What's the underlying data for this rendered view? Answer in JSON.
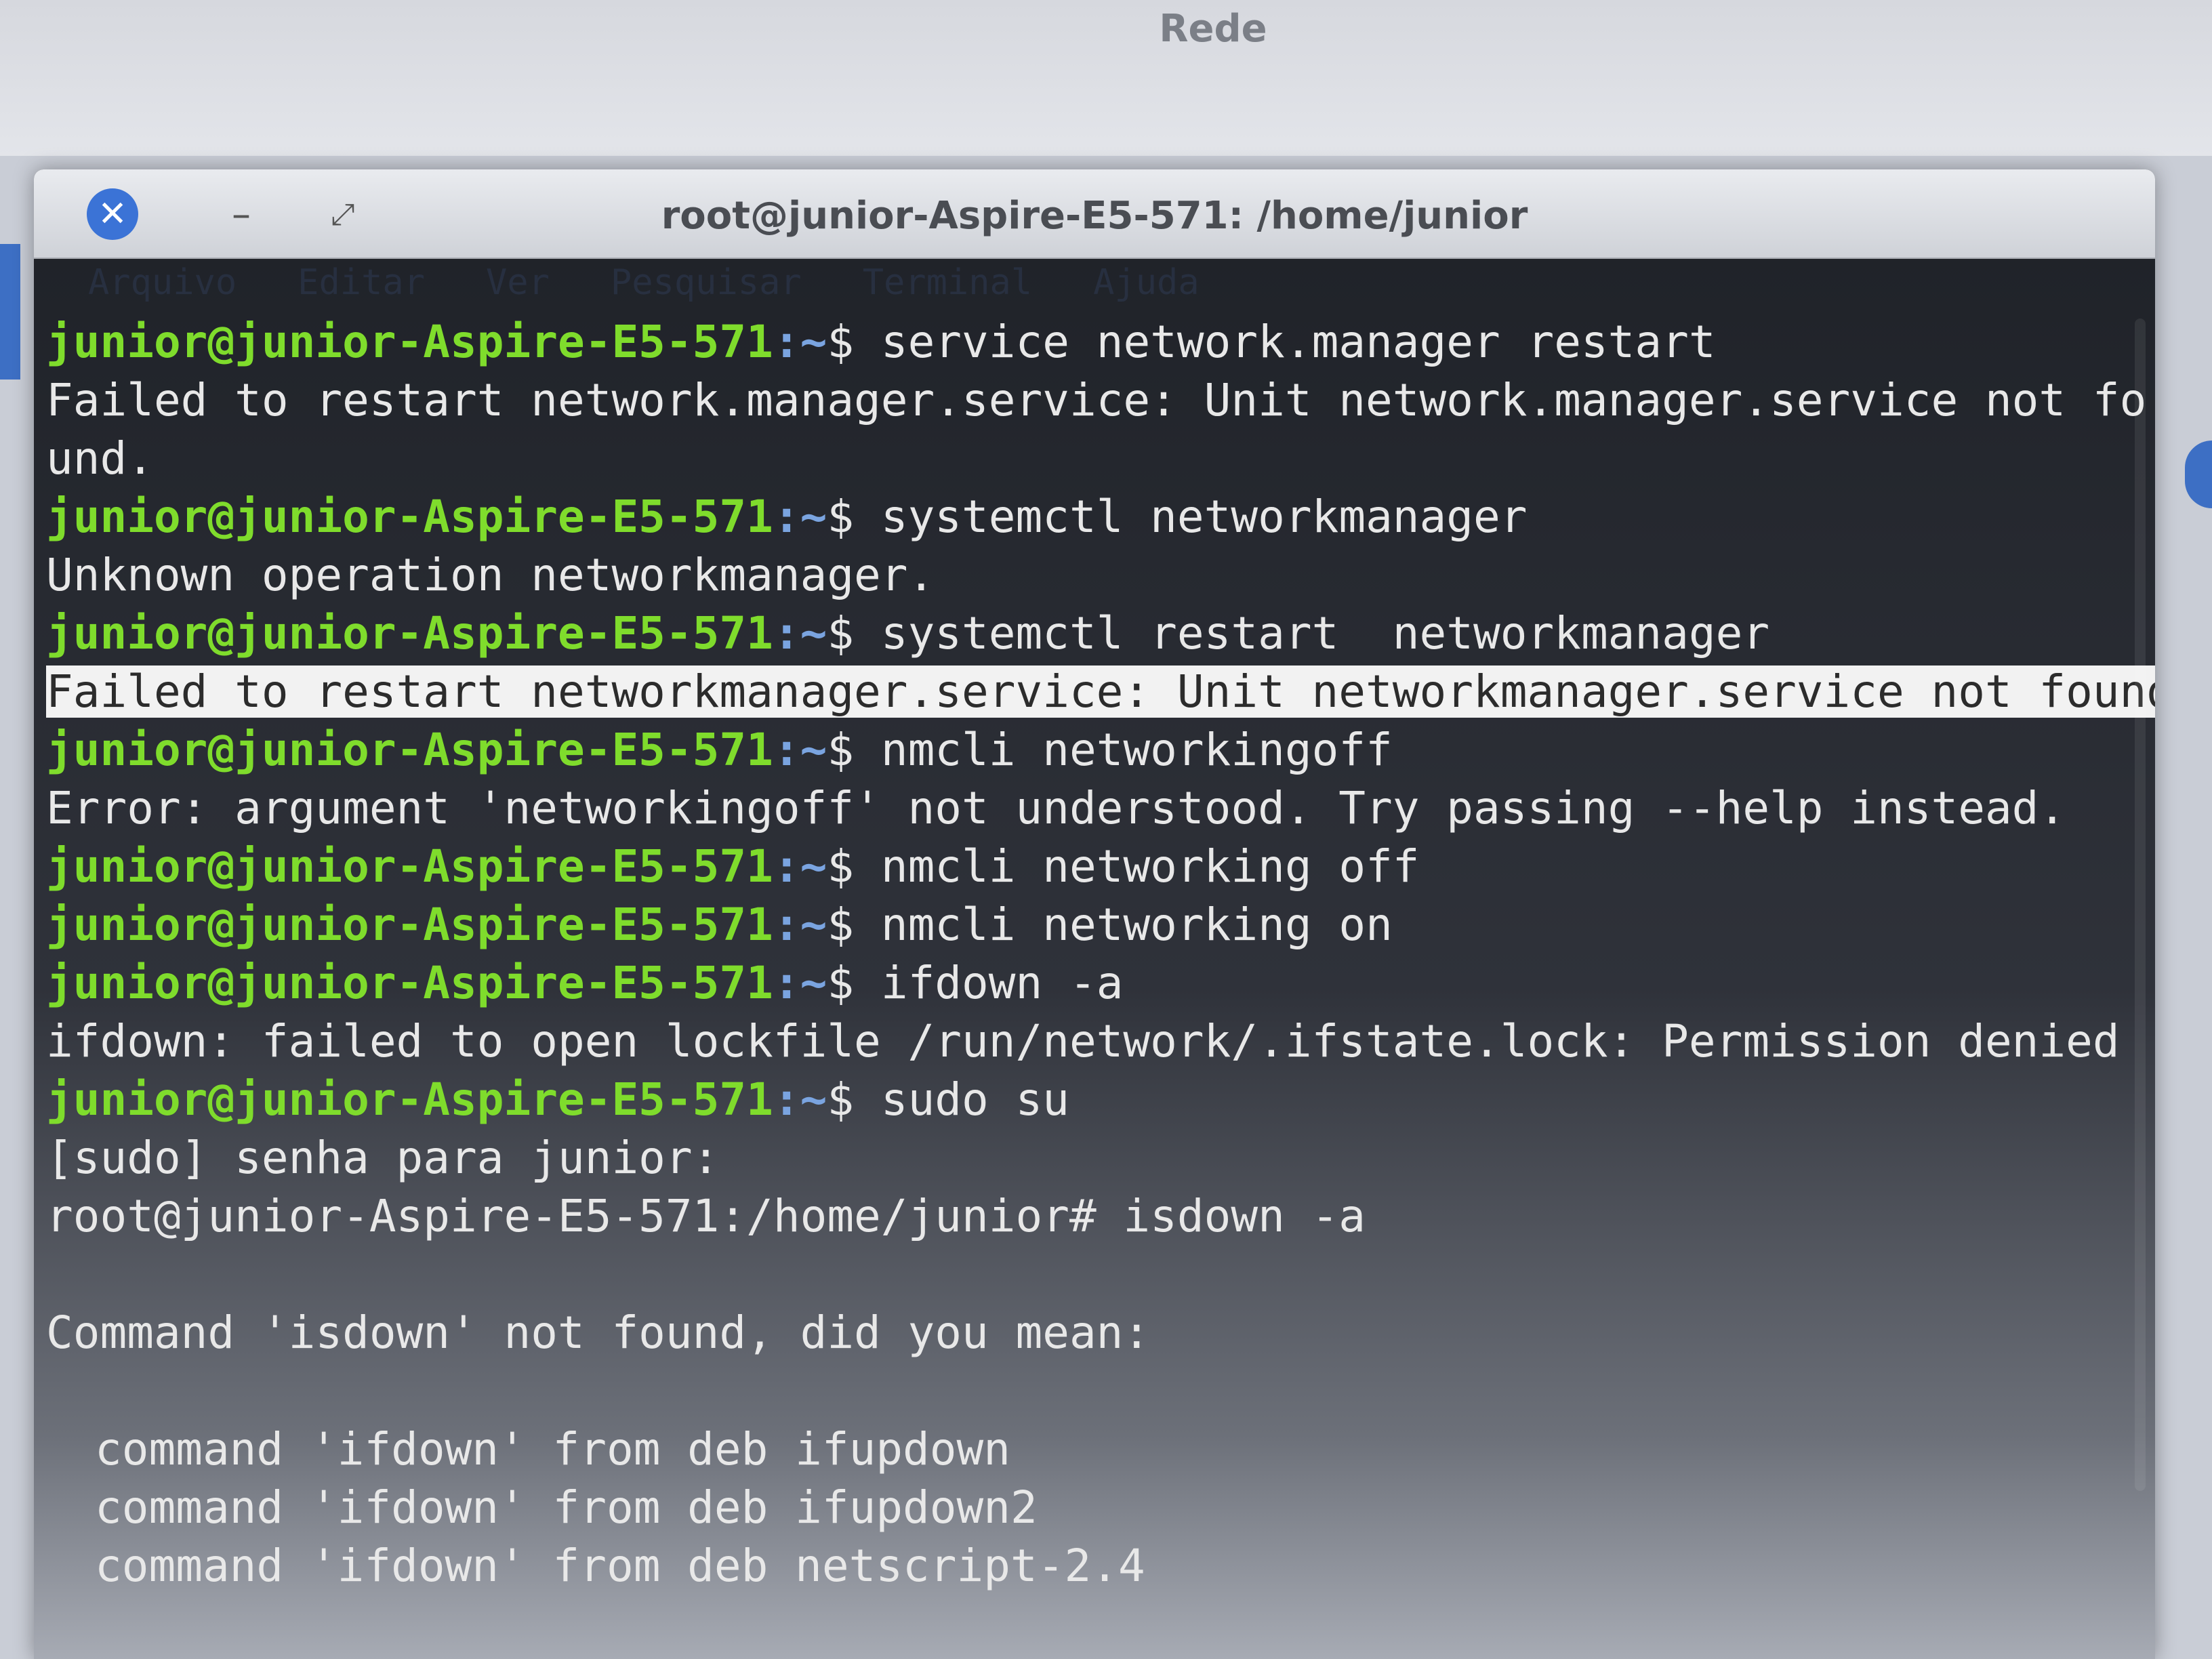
{
  "background_window": {
    "title": "Rede"
  },
  "window": {
    "title": "root@junior-Aspire-E5-571: /home/junior",
    "close_icon": "close-icon",
    "minimize_icon": "minimize-icon",
    "maximize_icon": "maximize-icon"
  },
  "menu": {
    "items": [
      "Arquivo",
      "Editar",
      "Ver",
      "Pesquisar",
      "Terminal",
      "Ajuda"
    ]
  },
  "prompt": {
    "user_host": "junior@junior-Aspire-E5-571",
    "path": ":~",
    "sign": "$ "
  },
  "terminal": {
    "cmd1": "service network.manager restart",
    "out1": "Failed to restart network.manager.service: Unit network.manager.service not found.",
    "cmd2": "systemctl networkmanager",
    "out2": "Unknown operation networkmanager.",
    "cmd3": "systemctl restart  networkmanager",
    "out3": "Failed to restart networkmanager.service: Unit networkmanager.service not found.",
    "cmd4": "nmcli networkingoff",
    "out4": "Error: argument 'networkingoff' not understood. Try passing --help instead.",
    "cmd5": "nmcli networking off",
    "cmd6": "nmcli networking on",
    "cmd7": "ifdown -a",
    "out7": "ifdown: failed to open lockfile /run/network/.ifstate.lock: Permission denied",
    "cmd8": "sudo su",
    "sudo_prompt": "[sudo] senha para junior:",
    "root_line": "root@junior-Aspire-E5-571:/home/junior# isdown -a",
    "not_found": "Command 'isdown' not found, did you mean:",
    "suggest1": "command 'ifdown' from deb ifupdown",
    "suggest2": "command 'ifdown' from deb ifupdown2",
    "suggest3": "command 'ifdown' from deb netscript-2.4"
  },
  "colors": {
    "prompt_user": "#7fdc2c",
    "prompt_path": "#7aa4e0",
    "close_button": "#3b73d6",
    "selection": "#f2f2f2"
  }
}
